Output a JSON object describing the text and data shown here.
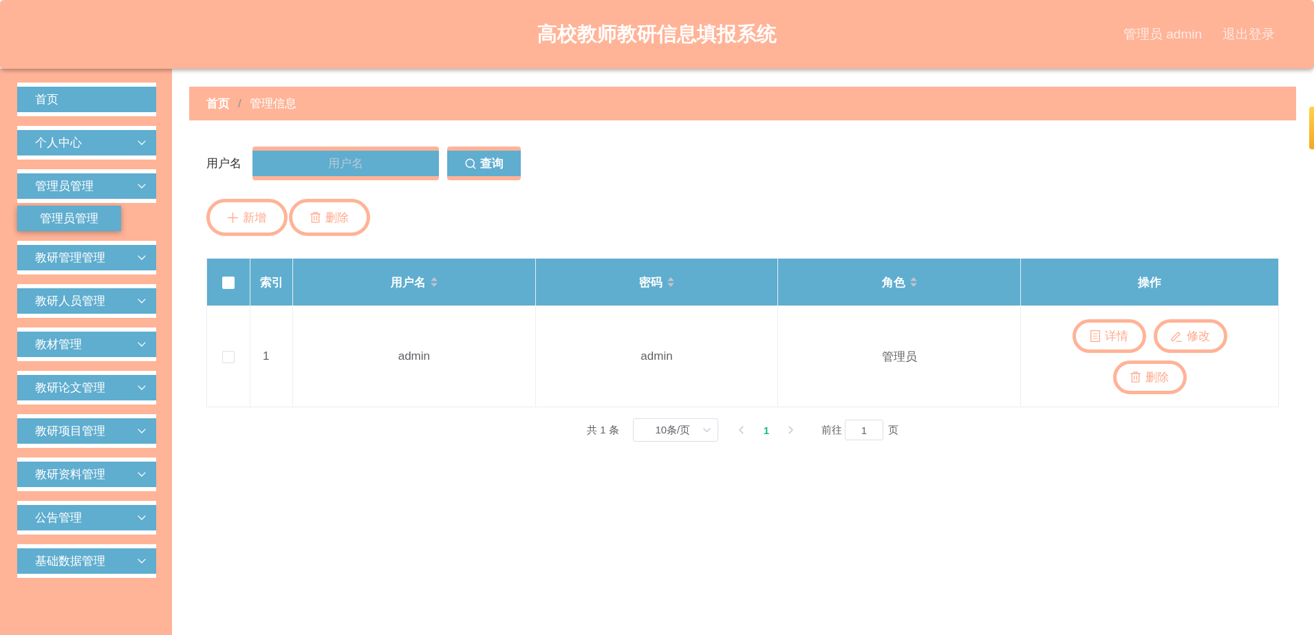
{
  "header": {
    "title": "高校教师教研信息填报系统",
    "user": "管理员 admin",
    "logout": "退出登录"
  },
  "sidebar": {
    "items": [
      {
        "label": "首页",
        "kind": "link"
      },
      {
        "label": "个人中心",
        "kind": "submenu"
      },
      {
        "label": "管理员管理",
        "kind": "submenu",
        "children": [
          {
            "label": "管理员管理"
          }
        ]
      },
      {
        "label": "教研管理管理",
        "kind": "submenu"
      },
      {
        "label": "教研人员管理",
        "kind": "submenu"
      },
      {
        "label": "教材管理",
        "kind": "submenu"
      },
      {
        "label": "教研论文管理",
        "kind": "submenu"
      },
      {
        "label": "教研项目管理",
        "kind": "submenu"
      },
      {
        "label": "教研资料管理",
        "kind": "submenu"
      },
      {
        "label": "公告管理",
        "kind": "submenu"
      },
      {
        "label": "基础数据管理",
        "kind": "submenu"
      }
    ]
  },
  "breadcrumb": {
    "separator": "/",
    "items": [
      {
        "label": "首页",
        "kind": "link"
      },
      {
        "label": "管理信息",
        "kind": "current"
      }
    ]
  },
  "search": {
    "label": "用户名",
    "placeholder": "用户名",
    "button": "查询"
  },
  "actions": [
    {
      "label": "新增",
      "kind": "add"
    },
    {
      "label": "删除",
      "kind": "delete"
    }
  ],
  "table": {
    "columns": [
      {
        "kind": "checkbox",
        "checked": false
      },
      {
        "kind": "index",
        "label": "索引",
        "sortable": false
      },
      {
        "kind": "text",
        "label": "用户名",
        "sortable": true
      },
      {
        "kind": "text",
        "label": "密码",
        "sortable": true
      },
      {
        "kind": "text",
        "label": "角色",
        "sortable": true
      },
      {
        "kind": "actions",
        "label": "操作",
        "sortable": false
      }
    ],
    "rows": [
      {
        "cells": [
          {
            "checked": false
          },
          {
            "text": "1"
          },
          {
            "text": "admin"
          },
          {
            "text": "admin"
          },
          {
            "text": "管理员"
          },
          {
            "actions": [
              {
                "label": "详情",
                "kind": "detail"
              },
              {
                "label": "修改",
                "kind": "edit"
              },
              {
                "label": "删除",
                "kind": "delete"
              }
            ]
          }
        ]
      }
    ]
  },
  "pagination": {
    "total": "共 1 条",
    "page_size": "10条/页",
    "prev": {
      "disabled": true
    },
    "pages": [
      {
        "label": "1",
        "selected": true
      }
    ],
    "next": {
      "disabled": true
    },
    "goto_label": "前往",
    "goto_value": "1",
    "goto_suffix": "页"
  }
}
